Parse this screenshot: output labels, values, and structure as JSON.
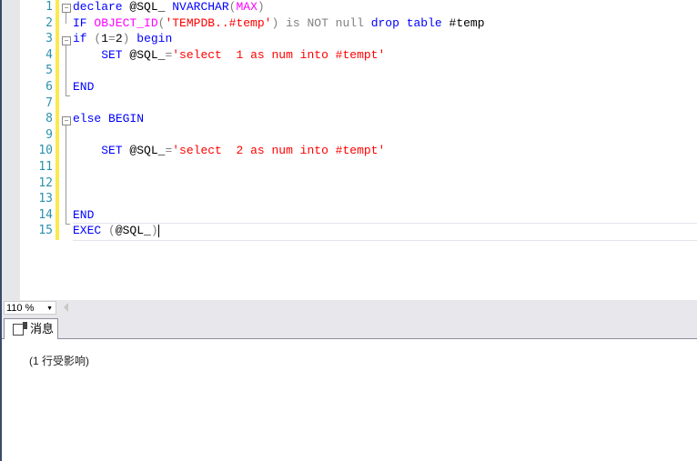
{
  "editor": {
    "lines": [
      [
        [
          "declare ",
          "kw"
        ],
        [
          "@SQL_ ",
          "tx"
        ],
        [
          "NVARCHAR",
          "kw"
        ],
        [
          "(",
          "gr"
        ],
        [
          "MAX",
          "fn"
        ],
        [
          ")",
          "gr"
        ]
      ],
      [
        [
          "IF ",
          "kw"
        ],
        [
          "OBJECT_ID",
          "fn"
        ],
        [
          "(",
          "gr"
        ],
        [
          "'TEMPDB..#temp'",
          "str"
        ],
        [
          ") ",
          "gr"
        ],
        [
          "is NOT null ",
          "gr"
        ],
        [
          "drop table ",
          "kw"
        ],
        [
          "#temp",
          "tx"
        ]
      ],
      [
        [
          "if ",
          "kw"
        ],
        [
          "(",
          "gr"
        ],
        [
          "1",
          "tx"
        ],
        [
          "=",
          "gr"
        ],
        [
          "2",
          "tx"
        ],
        [
          ") ",
          "gr"
        ],
        [
          "begin",
          "kw"
        ]
      ],
      [
        [
          "    SET ",
          "kw"
        ],
        [
          "@SQL_",
          "tx"
        ],
        [
          "=",
          "gr"
        ],
        [
          "'select  1 as num into #tempt'",
          "str"
        ]
      ],
      [],
      [
        [
          "END",
          "kw"
        ]
      ],
      [],
      [
        [
          "else ",
          "kw"
        ],
        [
          "BEGIN",
          "kw"
        ]
      ],
      [],
      [
        [
          "    SET ",
          "kw"
        ],
        [
          "@SQL_",
          "tx"
        ],
        [
          "=",
          "gr"
        ],
        [
          "'select  2 as num into #tempt'",
          "str"
        ]
      ],
      [],
      [],
      [],
      [
        [
          "END",
          "kw"
        ]
      ],
      [
        [
          "EXEC ",
          "kw"
        ],
        [
          "(",
          "gr"
        ],
        [
          "@SQL_",
          "tx"
        ],
        [
          ")",
          "gr"
        ]
      ]
    ]
  },
  "zoom": {
    "value": "110 %"
  },
  "results": {
    "tab_label": "消息",
    "message": "(1 行受影响)"
  }
}
